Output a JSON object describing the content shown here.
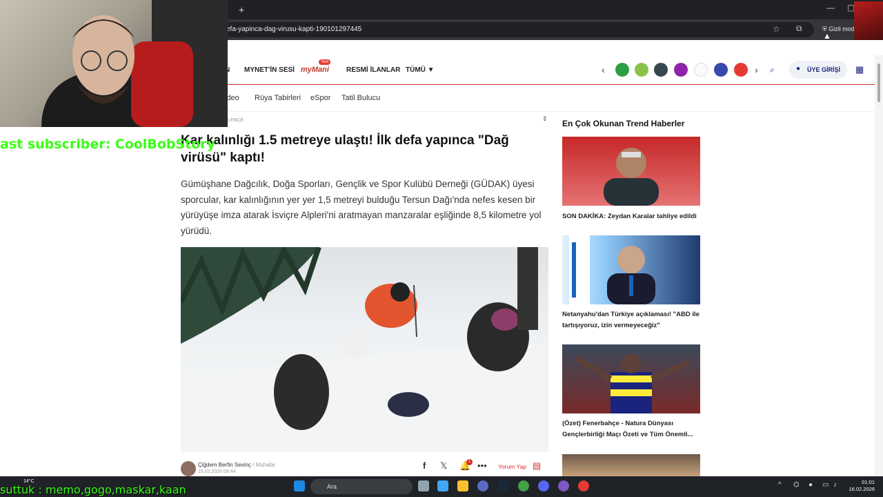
{
  "browser": {
    "new_tab": "+",
    "url": "efa-yapinca-dag-virusu-kapti-190101297445",
    "incognito_label": "Gizli mod",
    "minimize": "—",
    "maximize": "▢"
  },
  "site_nav": {
    "partial_item": "N",
    "items": [
      "MYNET'İN SESİ",
      "RESMİ İLANLAR",
      "TÜMÜ ▼"
    ],
    "mymani_label": "myMani",
    "mymani_badge": "Yeni",
    "login_label": "ÜYE GİRİŞİ"
  },
  "sub_nav": {
    "items": [
      "ideo",
      "Rüya Tabirleri",
      "eSpor",
      "Tatil Bulucu"
    ]
  },
  "article": {
    "breadcrumb": "LENCE",
    "title": "Kar kalınlığı 1.5 metreye ulaştı! İlk defa yapınca \"Dağ virüsü\" kaptı!",
    "lead": "Gümüşhane Dağcılık, Doğa Sporları, Gençlik ve Spor Kulübü Derneği (GÜDAK) üyesi sporcular, kar kalınlığının yer yer 1,5 metreyi bulduğu Tersun Dağı'nda nefes kesen bir yürüyüşe imza atarak İsviçre Alpleri'ni aratmayan manzaralar eşliğinde 8,5 kilometre yol yürüdü.",
    "author": "Çiğdem Berfin Sevinç",
    "author_role": "/ Muhabir",
    "date": "15.02.2026 08:44",
    "comment_label": "Yorum Yap",
    "notif_count": "1"
  },
  "trend": {
    "title": "En Çok Okunan Trend Haberler",
    "items": [
      {
        "caption": "SON DAKİKA: Zeydan Karalar tahliye edildi"
      },
      {
        "caption": "Netanyahu'dan Türkiye açıklaması! \"ABD ile tartışıyoruz, izin vermeyeceğiz\""
      },
      {
        "caption": "(Özet) Fenerbahçe - Natura Dünyası Gençlerbirliği Maçı Özeti ve Tüm Önemli..."
      }
    ]
  },
  "overlays": {
    "subscriber": "ast subscriber: CoolBobStory",
    "ticker": "suttuk : memo,gogo,maskar,kaan"
  },
  "taskbar": {
    "temp": "14°C",
    "search_label": "Ara",
    "time": "01:01",
    "date": "16.02.2026"
  },
  "colors": {
    "accent_red": "#d32f2f",
    "brand_navy": "#1a237e",
    "overlay_green": "#39ff14"
  }
}
